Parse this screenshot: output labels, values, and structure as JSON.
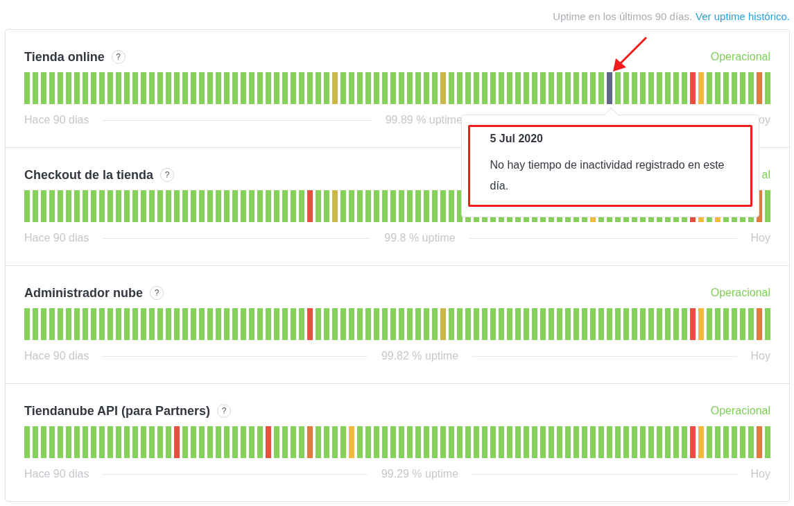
{
  "header": {
    "caption": "Uptime en los últimos 90 días.",
    "link": "Ver uptime histórico."
  },
  "components": [
    {
      "name": "Tienda online",
      "help": "?",
      "status": "Operacional",
      "start_label": "Hace 90 dias",
      "uptime": "99.89 % uptime",
      "end_label": "oy",
      "days": [
        {
          "color": "#86d15c"
        },
        {
          "color": "#86d15c"
        },
        {
          "color": "#86d15c"
        },
        {
          "color": "#86d15c"
        },
        {
          "color": "#86d15c"
        },
        {
          "color": "#86d15c"
        },
        {
          "color": "#86d15c"
        },
        {
          "color": "#86d15c"
        },
        {
          "color": "#86d15c"
        },
        {
          "color": "#86d15c"
        },
        {
          "color": "#86d15c"
        },
        {
          "color": "#86d15c"
        },
        {
          "color": "#86d15c"
        },
        {
          "color": "#86d15c"
        },
        {
          "color": "#86d15c"
        },
        {
          "color": "#86d15c"
        },
        {
          "color": "#86d15c"
        },
        {
          "color": "#86d15c"
        },
        {
          "color": "#86d15c"
        },
        {
          "color": "#86d15c"
        },
        {
          "color": "#86d15c"
        },
        {
          "color": "#86d15c"
        },
        {
          "color": "#86d15c"
        },
        {
          "color": "#86d15c"
        },
        {
          "color": "#86d15c"
        },
        {
          "color": "#86d15c"
        },
        {
          "color": "#86d15c"
        },
        {
          "color": "#86d15c"
        },
        {
          "color": "#86d15c"
        },
        {
          "color": "#86d15c"
        },
        {
          "color": "#86d15c"
        },
        {
          "color": "#86d15c"
        },
        {
          "color": "#86d15c"
        },
        {
          "color": "#86d15c"
        },
        {
          "color": "#86d15c"
        },
        {
          "color": "#86d15c"
        },
        {
          "color": "#86d15c"
        },
        {
          "color": "#cbb84a"
        },
        {
          "color": "#86d15c"
        },
        {
          "color": "#86d15c"
        },
        {
          "color": "#86d15c"
        },
        {
          "color": "#86d15c"
        },
        {
          "color": "#86d15c"
        },
        {
          "color": "#86d15c"
        },
        {
          "color": "#86d15c"
        },
        {
          "color": "#86d15c"
        },
        {
          "color": "#86d15c"
        },
        {
          "color": "#86d15c"
        },
        {
          "color": "#86d15c"
        },
        {
          "color": "#86d15c"
        },
        {
          "color": "#cbb84a"
        },
        {
          "color": "#86d15c"
        },
        {
          "color": "#86d15c"
        },
        {
          "color": "#86d15c"
        },
        {
          "color": "#86d15c"
        },
        {
          "color": "#86d15c"
        },
        {
          "color": "#86d15c"
        },
        {
          "color": "#86d15c"
        },
        {
          "color": "#86d15c"
        },
        {
          "color": "#86d15c"
        },
        {
          "color": "#86d15c"
        },
        {
          "color": "#86d15c"
        },
        {
          "color": "#86d15c"
        },
        {
          "color": "#86d15c"
        },
        {
          "color": "#86d15c"
        },
        {
          "color": "#86d15c"
        },
        {
          "color": "#86d15c"
        },
        {
          "color": "#86d15c"
        },
        {
          "color": "#86d15c"
        },
        {
          "color": "#86d15c"
        },
        {
          "color": "#5e6882",
          "tooltip": {
            "date": "5 Jul 2020",
            "text": "No hay tiempo de inactividad registrado en este día."
          }
        },
        {
          "color": "#86d15c"
        },
        {
          "color": "#86d15c"
        },
        {
          "color": "#86d15c"
        },
        {
          "color": "#86d15c"
        },
        {
          "color": "#86d15c"
        },
        {
          "color": "#86d15c"
        },
        {
          "color": "#86d15c"
        },
        {
          "color": "#86d15c"
        },
        {
          "color": "#86d15c"
        },
        {
          "color": "#e84f3d"
        },
        {
          "color": "#f2b93b"
        },
        {
          "color": "#86d15c"
        },
        {
          "color": "#86d15c"
        },
        {
          "color": "#86d15c"
        },
        {
          "color": "#86d15c"
        },
        {
          "color": "#86d15c"
        },
        {
          "color": "#86d15c"
        },
        {
          "color": "#e27a3f"
        },
        {
          "color": "#86d15c"
        }
      ]
    },
    {
      "name": "Checkout de la tienda",
      "help": "?",
      "status": "al",
      "start_label": "Hace 90 dias",
      "uptime": "99.8 % uptime",
      "end_label": "Hoy",
      "days": [
        {
          "color": "#86d15c"
        },
        {
          "color": "#86d15c"
        },
        {
          "color": "#86d15c"
        },
        {
          "color": "#86d15c"
        },
        {
          "color": "#86d15c"
        },
        {
          "color": "#86d15c"
        },
        {
          "color": "#86d15c"
        },
        {
          "color": "#86d15c"
        },
        {
          "color": "#86d15c"
        },
        {
          "color": "#86d15c"
        },
        {
          "color": "#86d15c"
        },
        {
          "color": "#86d15c"
        },
        {
          "color": "#86d15c"
        },
        {
          "color": "#86d15c"
        },
        {
          "color": "#86d15c"
        },
        {
          "color": "#86d15c"
        },
        {
          "color": "#86d15c"
        },
        {
          "color": "#86d15c"
        },
        {
          "color": "#86d15c"
        },
        {
          "color": "#86d15c"
        },
        {
          "color": "#86d15c"
        },
        {
          "color": "#86d15c"
        },
        {
          "color": "#86d15c"
        },
        {
          "color": "#86d15c"
        },
        {
          "color": "#86d15c"
        },
        {
          "color": "#86d15c"
        },
        {
          "color": "#86d15c"
        },
        {
          "color": "#86d15c"
        },
        {
          "color": "#86d15c"
        },
        {
          "color": "#86d15c"
        },
        {
          "color": "#86d15c"
        },
        {
          "color": "#86d15c"
        },
        {
          "color": "#86d15c"
        },
        {
          "color": "#86d15c"
        },
        {
          "color": "#e84f3d"
        },
        {
          "color": "#86d15c"
        },
        {
          "color": "#86d15c"
        },
        {
          "color": "#cbb84a"
        },
        {
          "color": "#86d15c"
        },
        {
          "color": "#86d15c"
        },
        {
          "color": "#86d15c"
        },
        {
          "color": "#86d15c"
        },
        {
          "color": "#86d15c"
        },
        {
          "color": "#86d15c"
        },
        {
          "color": "#86d15c"
        },
        {
          "color": "#86d15c"
        },
        {
          "color": "#86d15c"
        },
        {
          "color": "#86d15c"
        },
        {
          "color": "#86d15c"
        },
        {
          "color": "#86d15c"
        },
        {
          "color": "#86d15c"
        },
        {
          "color": "#86d15c"
        },
        {
          "color": "#86d15c"
        },
        {
          "color": "#86d15c"
        },
        {
          "color": "#86d15c"
        },
        {
          "color": "#86d15c"
        },
        {
          "color": "#86d15c"
        },
        {
          "color": "#86d15c"
        },
        {
          "color": "#86d15c"
        },
        {
          "color": "#86d15c"
        },
        {
          "color": "#86d15c"
        },
        {
          "color": "#86d15c"
        },
        {
          "color": "#86d15c"
        },
        {
          "color": "#86d15c"
        },
        {
          "color": "#86d15c"
        },
        {
          "color": "#86d15c"
        },
        {
          "color": "#86d15c"
        },
        {
          "color": "#86d15c"
        },
        {
          "color": "#f2b93b"
        },
        {
          "color": "#86d15c"
        },
        {
          "color": "#86d15c"
        },
        {
          "color": "#86d15c"
        },
        {
          "color": "#86d15c"
        },
        {
          "color": "#86d15c"
        },
        {
          "color": "#86d15c"
        },
        {
          "color": "#86d15c"
        },
        {
          "color": "#86d15c"
        },
        {
          "color": "#86d15c"
        },
        {
          "color": "#86d15c"
        },
        {
          "color": "#86d15c"
        },
        {
          "color": "#e84f3d"
        },
        {
          "color": "#f2b93b"
        },
        {
          "color": "#86d15c"
        },
        {
          "color": "#f2b93b"
        },
        {
          "color": "#86d15c"
        },
        {
          "color": "#86d15c"
        },
        {
          "color": "#86d15c"
        },
        {
          "color": "#86d15c"
        },
        {
          "color": "#e27a3f"
        },
        {
          "color": "#86d15c"
        }
      ]
    },
    {
      "name": "Administrador nube",
      "help": "?",
      "status": "Operacional",
      "start_label": "Hace 90 dias",
      "uptime": "99.82 % uptime",
      "end_label": "Hoy",
      "days": [
        {
          "color": "#86d15c"
        },
        {
          "color": "#86d15c"
        },
        {
          "color": "#86d15c"
        },
        {
          "color": "#86d15c"
        },
        {
          "color": "#86d15c"
        },
        {
          "color": "#86d15c"
        },
        {
          "color": "#86d15c"
        },
        {
          "color": "#86d15c"
        },
        {
          "color": "#86d15c"
        },
        {
          "color": "#86d15c"
        },
        {
          "color": "#86d15c"
        },
        {
          "color": "#86d15c"
        },
        {
          "color": "#86d15c"
        },
        {
          "color": "#86d15c"
        },
        {
          "color": "#86d15c"
        },
        {
          "color": "#86d15c"
        },
        {
          "color": "#86d15c"
        },
        {
          "color": "#86d15c"
        },
        {
          "color": "#86d15c"
        },
        {
          "color": "#86d15c"
        },
        {
          "color": "#86d15c"
        },
        {
          "color": "#86d15c"
        },
        {
          "color": "#86d15c"
        },
        {
          "color": "#86d15c"
        },
        {
          "color": "#86d15c"
        },
        {
          "color": "#86d15c"
        },
        {
          "color": "#86d15c"
        },
        {
          "color": "#86d15c"
        },
        {
          "color": "#86d15c"
        },
        {
          "color": "#86d15c"
        },
        {
          "color": "#86d15c"
        },
        {
          "color": "#86d15c"
        },
        {
          "color": "#86d15c"
        },
        {
          "color": "#86d15c"
        },
        {
          "color": "#e84f3d"
        },
        {
          "color": "#86d15c"
        },
        {
          "color": "#86d15c"
        },
        {
          "color": "#86d15c"
        },
        {
          "color": "#86d15c"
        },
        {
          "color": "#86d15c"
        },
        {
          "color": "#86d15c"
        },
        {
          "color": "#86d15c"
        },
        {
          "color": "#86d15c"
        },
        {
          "color": "#86d15c"
        },
        {
          "color": "#86d15c"
        },
        {
          "color": "#86d15c"
        },
        {
          "color": "#86d15c"
        },
        {
          "color": "#86d15c"
        },
        {
          "color": "#86d15c"
        },
        {
          "color": "#86d15c"
        },
        {
          "color": "#cbb84a"
        },
        {
          "color": "#86d15c"
        },
        {
          "color": "#86d15c"
        },
        {
          "color": "#86d15c"
        },
        {
          "color": "#86d15c"
        },
        {
          "color": "#86d15c"
        },
        {
          "color": "#86d15c"
        },
        {
          "color": "#86d15c"
        },
        {
          "color": "#86d15c"
        },
        {
          "color": "#86d15c"
        },
        {
          "color": "#86d15c"
        },
        {
          "color": "#86d15c"
        },
        {
          "color": "#86d15c"
        },
        {
          "color": "#86d15c"
        },
        {
          "color": "#86d15c"
        },
        {
          "color": "#86d15c"
        },
        {
          "color": "#86d15c"
        },
        {
          "color": "#86d15c"
        },
        {
          "color": "#86d15c"
        },
        {
          "color": "#86d15c"
        },
        {
          "color": "#86d15c"
        },
        {
          "color": "#86d15c"
        },
        {
          "color": "#86d15c"
        },
        {
          "color": "#86d15c"
        },
        {
          "color": "#86d15c"
        },
        {
          "color": "#86d15c"
        },
        {
          "color": "#86d15c"
        },
        {
          "color": "#86d15c"
        },
        {
          "color": "#86d15c"
        },
        {
          "color": "#86d15c"
        },
        {
          "color": "#e84f3d"
        },
        {
          "color": "#f2b93b"
        },
        {
          "color": "#86d15c"
        },
        {
          "color": "#86d15c"
        },
        {
          "color": "#86d15c"
        },
        {
          "color": "#86d15c"
        },
        {
          "color": "#86d15c"
        },
        {
          "color": "#86d15c"
        },
        {
          "color": "#e27a3f"
        },
        {
          "color": "#86d15c"
        }
      ]
    },
    {
      "name": "Tiendanube API (para Partners)",
      "help": "?",
      "status": "Operacional",
      "start_label": "Hace 90 dias",
      "uptime": "99.29 % uptime",
      "end_label": "Hoy",
      "days": [
        {
          "color": "#86d15c"
        },
        {
          "color": "#86d15c"
        },
        {
          "color": "#86d15c"
        },
        {
          "color": "#86d15c"
        },
        {
          "color": "#86d15c"
        },
        {
          "color": "#86d15c"
        },
        {
          "color": "#86d15c"
        },
        {
          "color": "#86d15c"
        },
        {
          "color": "#86d15c"
        },
        {
          "color": "#86d15c"
        },
        {
          "color": "#86d15c"
        },
        {
          "color": "#86d15c"
        },
        {
          "color": "#86d15c"
        },
        {
          "color": "#86d15c"
        },
        {
          "color": "#86d15c"
        },
        {
          "color": "#86d15c"
        },
        {
          "color": "#86d15c"
        },
        {
          "color": "#86d15c"
        },
        {
          "color": "#e84f3d"
        },
        {
          "color": "#86d15c"
        },
        {
          "color": "#86d15c"
        },
        {
          "color": "#86d15c"
        },
        {
          "color": "#86d15c"
        },
        {
          "color": "#86d15c"
        },
        {
          "color": "#86d15c"
        },
        {
          "color": "#86d15c"
        },
        {
          "color": "#86d15c"
        },
        {
          "color": "#86d15c"
        },
        {
          "color": "#86d15c"
        },
        {
          "color": "#e84f3d"
        },
        {
          "color": "#86d15c"
        },
        {
          "color": "#86d15c"
        },
        {
          "color": "#86d15c"
        },
        {
          "color": "#86d15c"
        },
        {
          "color": "#e27a3f"
        },
        {
          "color": "#86d15c"
        },
        {
          "color": "#86d15c"
        },
        {
          "color": "#86d15c"
        },
        {
          "color": "#86d15c"
        },
        {
          "color": "#f2b93b"
        },
        {
          "color": "#86d15c"
        },
        {
          "color": "#86d15c"
        },
        {
          "color": "#86d15c"
        },
        {
          "color": "#86d15c"
        },
        {
          "color": "#86d15c"
        },
        {
          "color": "#86d15c"
        },
        {
          "color": "#86d15c"
        },
        {
          "color": "#86d15c"
        },
        {
          "color": "#86d15c"
        },
        {
          "color": "#86d15c"
        },
        {
          "color": "#86d15c"
        },
        {
          "color": "#86d15c"
        },
        {
          "color": "#86d15c"
        },
        {
          "color": "#86d15c"
        },
        {
          "color": "#86d15c"
        },
        {
          "color": "#86d15c"
        },
        {
          "color": "#86d15c"
        },
        {
          "color": "#86d15c"
        },
        {
          "color": "#86d15c"
        },
        {
          "color": "#86d15c"
        },
        {
          "color": "#86d15c"
        },
        {
          "color": "#86d15c"
        },
        {
          "color": "#86d15c"
        },
        {
          "color": "#86d15c"
        },
        {
          "color": "#86d15c"
        },
        {
          "color": "#86d15c"
        },
        {
          "color": "#86d15c"
        },
        {
          "color": "#86d15c"
        },
        {
          "color": "#86d15c"
        },
        {
          "color": "#86d15c"
        },
        {
          "color": "#86d15c"
        },
        {
          "color": "#86d15c"
        },
        {
          "color": "#86d15c"
        },
        {
          "color": "#86d15c"
        },
        {
          "color": "#86d15c"
        },
        {
          "color": "#86d15c"
        },
        {
          "color": "#86d15c"
        },
        {
          "color": "#86d15c"
        },
        {
          "color": "#86d15c"
        },
        {
          "color": "#86d15c"
        },
        {
          "color": "#e84f3d"
        },
        {
          "color": "#f2b93b"
        },
        {
          "color": "#86d15c"
        },
        {
          "color": "#86d15c"
        },
        {
          "color": "#86d15c"
        },
        {
          "color": "#86d15c"
        },
        {
          "color": "#86d15c"
        },
        {
          "color": "#86d15c"
        },
        {
          "color": "#e27a3f"
        },
        {
          "color": "#86d15c"
        }
      ]
    }
  ],
  "annotations": {
    "highlight_box": true,
    "arrow": true
  }
}
